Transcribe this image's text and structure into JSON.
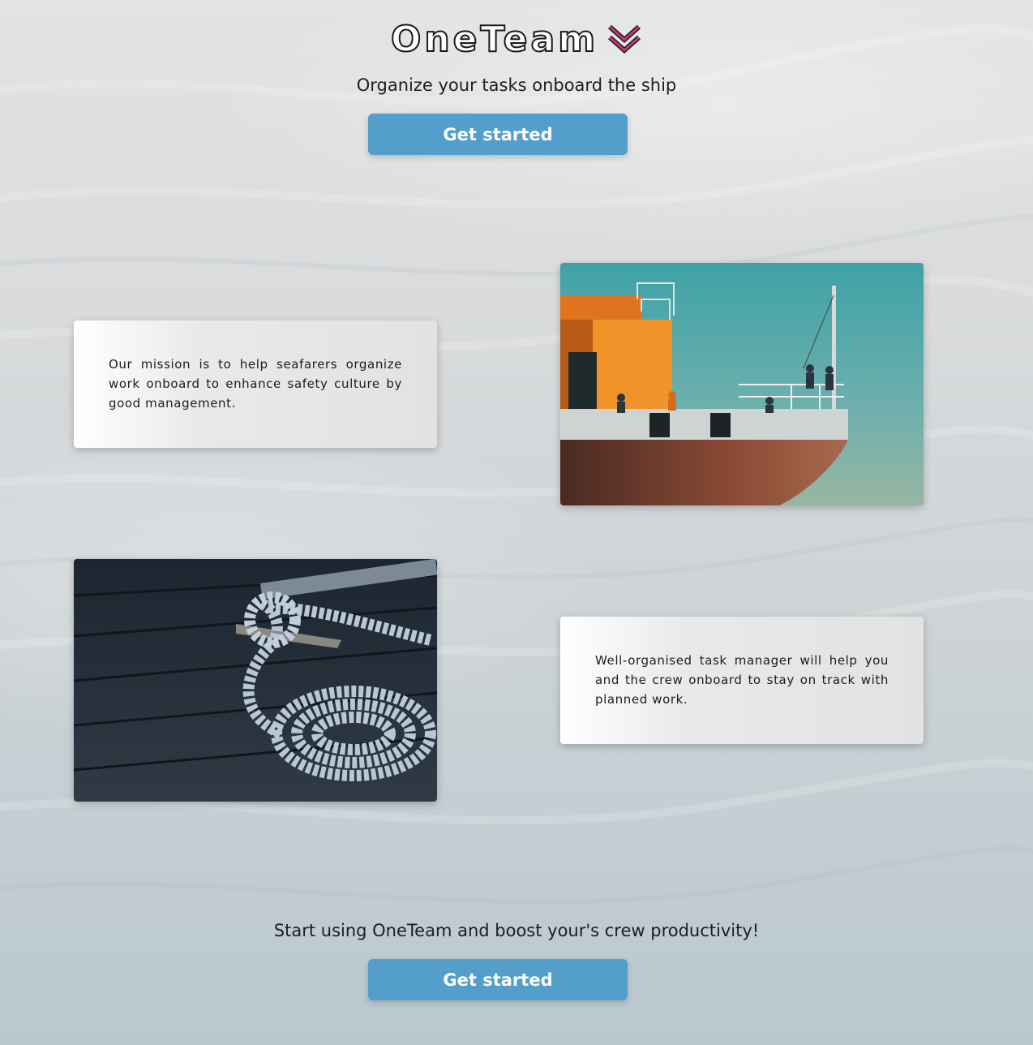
{
  "header": {
    "logo_text": "OneTeam",
    "tagline": "Organize your tasks onboard the ship",
    "cta_label": "Get started"
  },
  "features": [
    {
      "text": "Our mission is to help seafarers organize work onboard to enhance safety culture by good management.",
      "image": "ship-bow-photo"
    },
    {
      "text": "Well-organised task manager will help you and the crew onboard to stay on track with planned work.",
      "image": "mooring-rope-photo"
    }
  ],
  "footer": {
    "text": "Start using OneTeam and boost your's crew productivity!",
    "cta_label": "Get started"
  },
  "colors": {
    "button": "#539ecb",
    "accent_icon": "#c0397a"
  }
}
